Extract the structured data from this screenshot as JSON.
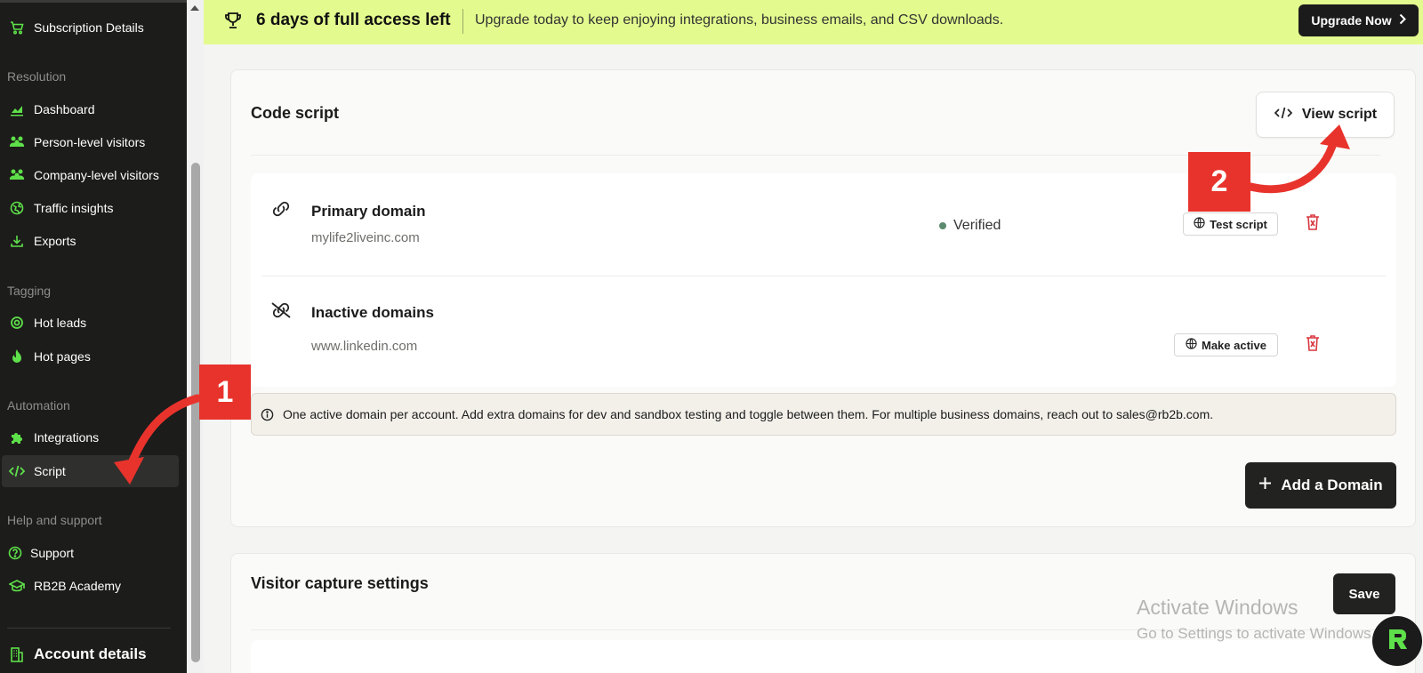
{
  "sidebar": {
    "subscription": "Subscription Details",
    "sections": {
      "resolution": "Resolution",
      "tagging": "Tagging",
      "automation": "Automation",
      "help": "Help and support"
    },
    "items": {
      "dashboard": "Dashboard",
      "person_visitors": "Person-level visitors",
      "company_visitors": "Company-level visitors",
      "traffic": "Traffic insights",
      "exports": "Exports",
      "hot_leads": "Hot leads",
      "hot_pages": "Hot pages",
      "integrations": "Integrations",
      "script": "Script",
      "support": "Support",
      "academy": "RB2B Academy"
    },
    "account": "Account details",
    "active_item": "Script"
  },
  "banner": {
    "title": "6 days of full access left",
    "message": "Upgrade today to keep enjoying integrations, business emails, and CSV downloads.",
    "button": "Upgrade Now"
  },
  "code_script": {
    "title": "Code script",
    "view_button": "View script",
    "primary": {
      "title": "Primary domain",
      "domain": "mylife2liveinc.com",
      "status": "Verified",
      "button": "Test script"
    },
    "inactive": {
      "title": "Inactive domains",
      "domain": "www.linkedin.com",
      "button": "Make active"
    },
    "info": "One active domain per account. Add extra domains for dev and sandbox testing and toggle between them. For multiple business domains, reach out to sales@rb2b.com.",
    "add_button": "Add a Domain"
  },
  "visitor_capture": {
    "title": "Visitor capture settings",
    "save_button": "Save"
  },
  "annotations": {
    "step1": "1",
    "step2": "2"
  },
  "watermark": {
    "line1": "Activate Windows",
    "line2": "Go to Settings to activate Windows."
  },
  "colors": {
    "accent_green": "#5ee04a",
    "banner_bg": "#e3fb8e",
    "annotation_red": "#e8332c",
    "delete_red": "#d9363e"
  }
}
